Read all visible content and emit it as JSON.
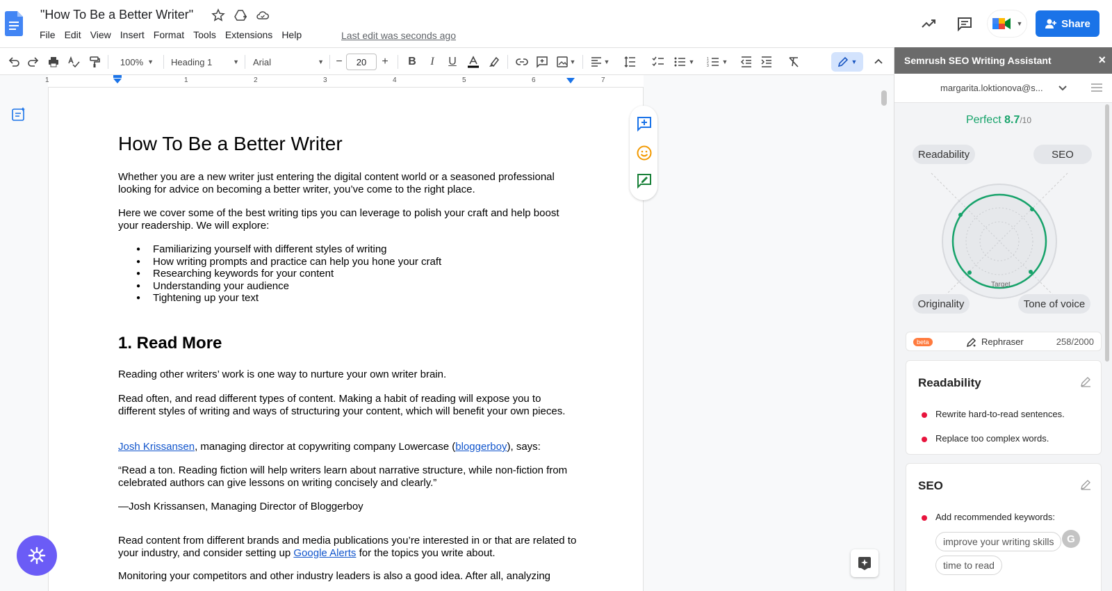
{
  "doc": {
    "title": "\"How To Be a Better Writer\"",
    "last_edit": "Last edit was seconds ago",
    "menus": [
      "File",
      "Edit",
      "View",
      "Insert",
      "Format",
      "Tools",
      "Extensions",
      "Help"
    ],
    "share_label": "Share"
  },
  "toolbar": {
    "zoom": "100%",
    "style": "Heading 1",
    "font": "Arial",
    "font_size": "20",
    "minus": "−",
    "plus": "+"
  },
  "ruler": [
    "1",
    "1",
    "2",
    "3",
    "4",
    "5",
    "6",
    "7"
  ],
  "content": {
    "h1": "How To Be a Better Writer",
    "p1": "Whether you are a new writer just entering the digital content world or a seasoned professional looking for advice on becoming a better writer, you’ve come to the right place.",
    "p2": "Here we cover some of the best writing tips you can leverage to polish your craft and help boost your readership. We will explore:",
    "bullets": [
      "Familiarizing yourself with different styles of writing",
      "How writing prompts and practice can help you hone your craft",
      "Researching keywords for your content",
      "Understanding your audience",
      "Tightening up your text"
    ],
    "h2": "1. Read More",
    "p3": "Reading other writers’ work is one way to nurture your own writer brain.",
    "p4": "Read often, and read different types of content. Making a habit of reading will expose you to different styles of writing and ways of structuring your content, which will benefit your own pieces.",
    "p5_link1": "Josh Krissansen",
    "p5_mid": ", managing director at copywriting company Lowercase (",
    "p5_link2": "bloggerboy",
    "p5_end": "), says:",
    "quote": "“Read a ton. Reading fiction will help writers learn about narrative structure, while non-fiction from celebrated authors can give lessons on writing concisely and clearly.”",
    "attribution": "—Josh Krissansen, Managing Director of Bloggerboy",
    "p6_start": "Read content from different brands and media publications you’re interested in or that are related to your industry, and consider setting up ",
    "p6_link": "Google Alerts",
    "p6_end": " for the topics you write about.",
    "p7": "Monitoring your competitors and other industry leaders is also a good idea. After all, analyzing"
  },
  "semrush": {
    "header": "Semrush SEO Writing Assistant",
    "close": "×",
    "email": "margarita.loktionova@s...",
    "score_label": "Perfect",
    "score_value": "8.7",
    "score_max": "/10",
    "score": 8.7,
    "radar_labels": {
      "top_left": "Readability",
      "top_right": "SEO",
      "bottom_left": "Originality",
      "bottom_right": "Tone of voice"
    },
    "target_label": "Target",
    "rephraser": {
      "badge": "beta",
      "label": "Rephraser",
      "count": "258/2000"
    },
    "readability_card": {
      "title": "Readability",
      "items": [
        "Rewrite hard-to-read sentences.",
        "Replace too complex words."
      ]
    },
    "seo_card": {
      "title": "SEO",
      "item": "Add recommended keywords:",
      "keywords": [
        "improve your writing skills",
        "time to read"
      ]
    },
    "g_badge": "G",
    "accent": "#16a36a",
    "alert": "#e8143d"
  }
}
